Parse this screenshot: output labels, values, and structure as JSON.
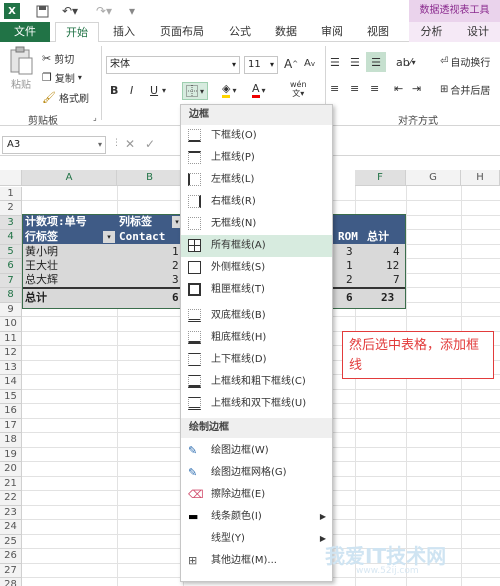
{
  "title_bar": {
    "context_title": "数据透视表工具"
  },
  "tabs": [
    {
      "label": "文件"
    },
    {
      "label": "开始"
    },
    {
      "label": "插入"
    },
    {
      "label": "页面布局"
    },
    {
      "label": "公式"
    },
    {
      "label": "数据"
    },
    {
      "label": "审阅"
    },
    {
      "label": "视图"
    },
    {
      "label": "分析"
    },
    {
      "label": "设计"
    }
  ],
  "ribbon": {
    "paste": "粘贴",
    "cut": "剪切",
    "copy": "复制",
    "format_painter": "格式刷",
    "clipboard_group": "剪贴板",
    "font_name": "宋体",
    "font_size": "11",
    "bold": "B",
    "italic": "I",
    "underline": "U",
    "wrap_text": "自动换行",
    "merge": "合并后居",
    "align_group": "对齐方式",
    "font_inc": "A",
    "font_dec": "A"
  },
  "formula_bar": {
    "name_box": "A3"
  },
  "columns": [
    "A",
    "B",
    "F",
    "G",
    "H"
  ],
  "rows": [
    "1",
    "2",
    "3",
    "4",
    "5",
    "6",
    "7",
    "8",
    "9",
    "10",
    "11",
    "12",
    "13",
    "14",
    "15",
    "16",
    "17",
    "18",
    "19",
    "20",
    "21",
    "22",
    "23",
    "24",
    "25",
    "26",
    "27",
    "28"
  ],
  "pivot": {
    "r3a": "计数项:单号",
    "r3b": "列标签",
    "r4a": "行标签",
    "r4b": "Contact",
    "r4e": "ROM",
    "r4f": "总计",
    "r5a": "黄小明",
    "r5b": "1",
    "r5e": "3",
    "r5f": "4",
    "r6a": "王大壮",
    "r6b": "2",
    "r6e": "1",
    "r6f": "12",
    "r7a": "总大辉",
    "r7b": "3",
    "r7e": "2",
    "r7f": "7",
    "r8a": "总计",
    "r8b": "6",
    "r8e": "6",
    "r8f": "23"
  },
  "menu": {
    "border_header": "边框",
    "items": [
      {
        "label": "下框线(O)"
      },
      {
        "label": "上框线(P)"
      },
      {
        "label": "左框线(L)"
      },
      {
        "label": "右框线(R)"
      },
      {
        "label": "无框线(N)"
      },
      {
        "label": "所有框线(A)"
      },
      {
        "label": "外侧框线(S)"
      },
      {
        "label": "粗匣框线(T)"
      },
      {
        "label": "双底框线(B)"
      },
      {
        "label": "粗底框线(H)"
      },
      {
        "label": "上下框线(D)"
      },
      {
        "label": "上框线和粗下框线(C)"
      },
      {
        "label": "上框线和双下框线(U)"
      }
    ],
    "draw_header": "绘制边框",
    "draw_items": [
      {
        "label": "绘图边框(W)"
      },
      {
        "label": "绘图边框网格(G)"
      },
      {
        "label": "擦除边框(E)"
      },
      {
        "label": "线条颜色(I)"
      },
      {
        "label": "线型(Y)"
      },
      {
        "label": "其他边框(M)..."
      }
    ]
  },
  "annotation": "然后选中表格，添加框线",
  "watermark": "我爱IT技术网",
  "watermark_url": "www.52ij.com",
  "colors": {
    "excel_green": "#217346",
    "pivot_header": "#3f5b86",
    "pivot_row": "#d9d9d9",
    "highlight": "#d7ebdf"
  }
}
